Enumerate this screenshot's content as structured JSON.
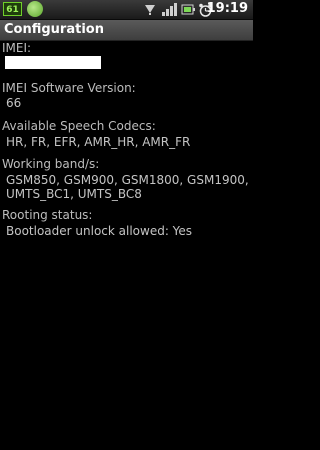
{
  "status_bar": {
    "badge_text": "61",
    "time": "19:19",
    "icons": [
      "app-circle-icon",
      "usb-debug-icon",
      "signal-icon",
      "battery-icon",
      "alarm-icon"
    ]
  },
  "title_bar": {
    "title": "Configuration"
  },
  "sections": {
    "imei": {
      "label": "IMEI:",
      "value": ""
    },
    "imei_sw": {
      "label": "IMEI Software Version:",
      "value": "66"
    },
    "codecs": {
      "label": "Available Speech Codecs:",
      "value": "HR, FR, EFR, AMR_HR, AMR_FR"
    },
    "bands": {
      "label": "Working band/s:",
      "value_line1": "GSM850, GSM900, GSM1800, GSM1900,",
      "value_line2": "UMTS_BC1, UMTS_BC8"
    },
    "rooting": {
      "label": "Rooting status:",
      "value": "Bootloader unlock allowed: Yes"
    }
  },
  "colors": {
    "background": "#000000",
    "text": "#bdbdbd",
    "badge_green": "#6fcf2a"
  }
}
